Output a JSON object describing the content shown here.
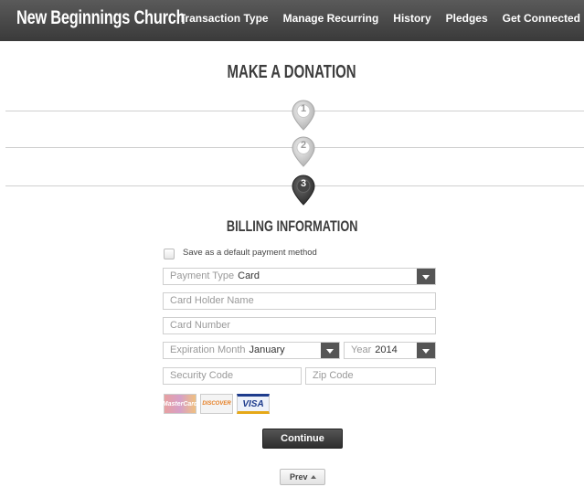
{
  "header": {
    "brand": "New Beginnings Church",
    "nav": [
      "Transaction Type",
      "Manage Recurring",
      "History",
      "Pledges",
      "Get Connected"
    ]
  },
  "page_title": "MAKE A DONATION",
  "steps": [
    {
      "label": "1",
      "state": "inactive"
    },
    {
      "label": "2",
      "state": "inactive"
    },
    {
      "label": "3",
      "state": "active"
    }
  ],
  "section_title": "BILLING INFORMATION",
  "form": {
    "save_default_label": "Save as a default payment method",
    "payment_type_label": "Payment Type",
    "payment_type_value": "Card",
    "card_holder_placeholder": "Card Holder Name",
    "card_number_placeholder": "Card Number",
    "exp_month_label": "Expiration Month",
    "exp_month_value": "January",
    "year_label": "Year",
    "year_value": "2014",
    "security_code_placeholder": "Security Code",
    "zip_code_placeholder": "Zip Code"
  },
  "cards": [
    "MasterCard",
    "DISCOVER",
    "VISA"
  ],
  "buttons": {
    "continue": "Continue",
    "prev": "Prev"
  },
  "colors": {
    "header_bg": "#4a4a4a",
    "active_step": "#3a3a3a",
    "inactive_step": "#c4c4c4"
  }
}
